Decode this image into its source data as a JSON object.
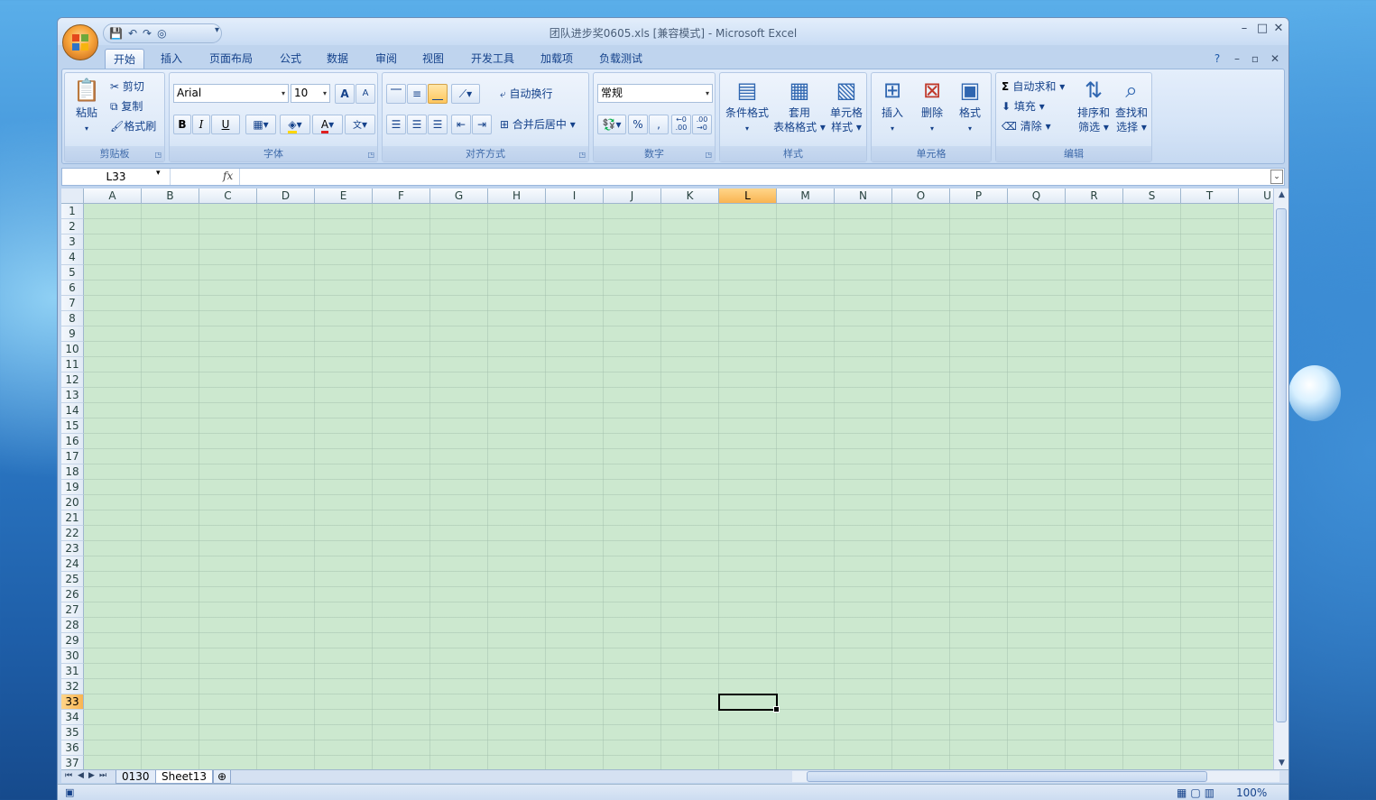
{
  "window": {
    "title": "团队进步奖0605.xls  [兼容模式] - Microsoft Excel",
    "minimize": "–",
    "maximize": "□",
    "close": "✕"
  },
  "quick_access": [
    "save-icon",
    "undo-icon",
    "redo-icon",
    "print-preview-icon"
  ],
  "tabs": [
    "开始",
    "插入",
    "页面布局",
    "公式",
    "数据",
    "审阅",
    "视图",
    "开发工具",
    "加载项",
    "负载测试"
  ],
  "active_tab": "开始",
  "ribbon": {
    "clipboard": {
      "label": "剪贴板",
      "paste": "粘贴",
      "cut": "剪切",
      "copy": "复制",
      "format_painter": "格式刷"
    },
    "font": {
      "label": "字体",
      "font_name": "Arial",
      "font_size": "10",
      "bold": "B",
      "italic": "I",
      "underline": "U",
      "grow": "A",
      "shrink": "A"
    },
    "alignment": {
      "label": "对齐方式",
      "wrap": "自动换行",
      "merge": "合并后居中"
    },
    "number": {
      "label": "数字",
      "format": "常规",
      "percent": "%",
      "comma": ",",
      "inc_decimal": "+.0\n.00",
      "dec_decimal": ".00\n+.0"
    },
    "styles": {
      "label": "样式",
      "conditional": "条件格式",
      "table_line1": "套用",
      "table_line2": "表格格式",
      "cell_line1": "单元格",
      "cell_line2": "样式"
    },
    "cells": {
      "label": "单元格",
      "insert": "插入",
      "delete": "删除",
      "format": "格式"
    },
    "editing": {
      "label": "编辑",
      "autosum": "自动求和",
      "fill": "填充",
      "clear": "清除",
      "sort_line1": "排序和",
      "sort_line2": "筛选",
      "find_line1": "查找和",
      "find_line2": "选择"
    }
  },
  "formula_bar": {
    "name_box": "L33",
    "fx": "fx",
    "content": ""
  },
  "columns": [
    "A",
    "B",
    "C",
    "D",
    "E",
    "F",
    "G",
    "H",
    "I",
    "J",
    "K",
    "L",
    "M",
    "N",
    "O",
    "P",
    "Q",
    "R",
    "S",
    "T",
    "U"
  ],
  "selected_column": "L",
  "rows": [
    "1",
    "2",
    "3",
    "4",
    "5",
    "6",
    "7",
    "8",
    "9",
    "10",
    "11",
    "12",
    "13",
    "14",
    "15",
    "16",
    "17",
    "18",
    "19",
    "20",
    "21",
    "22",
    "23",
    "24",
    "25",
    "26",
    "27",
    "28",
    "29",
    "30",
    "31",
    "32",
    "33",
    "34",
    "35",
    "36",
    "37"
  ],
  "selected_row": "33",
  "sheets": [
    "0130",
    "Sheet13"
  ],
  "active_sheet": "Sheet13",
  "status": {
    "zoom": "100%"
  },
  "colors": {
    "grid_fill": "#cce8cf",
    "selected_header": "#f9b451",
    "ribbon": "#dde9f8"
  }
}
